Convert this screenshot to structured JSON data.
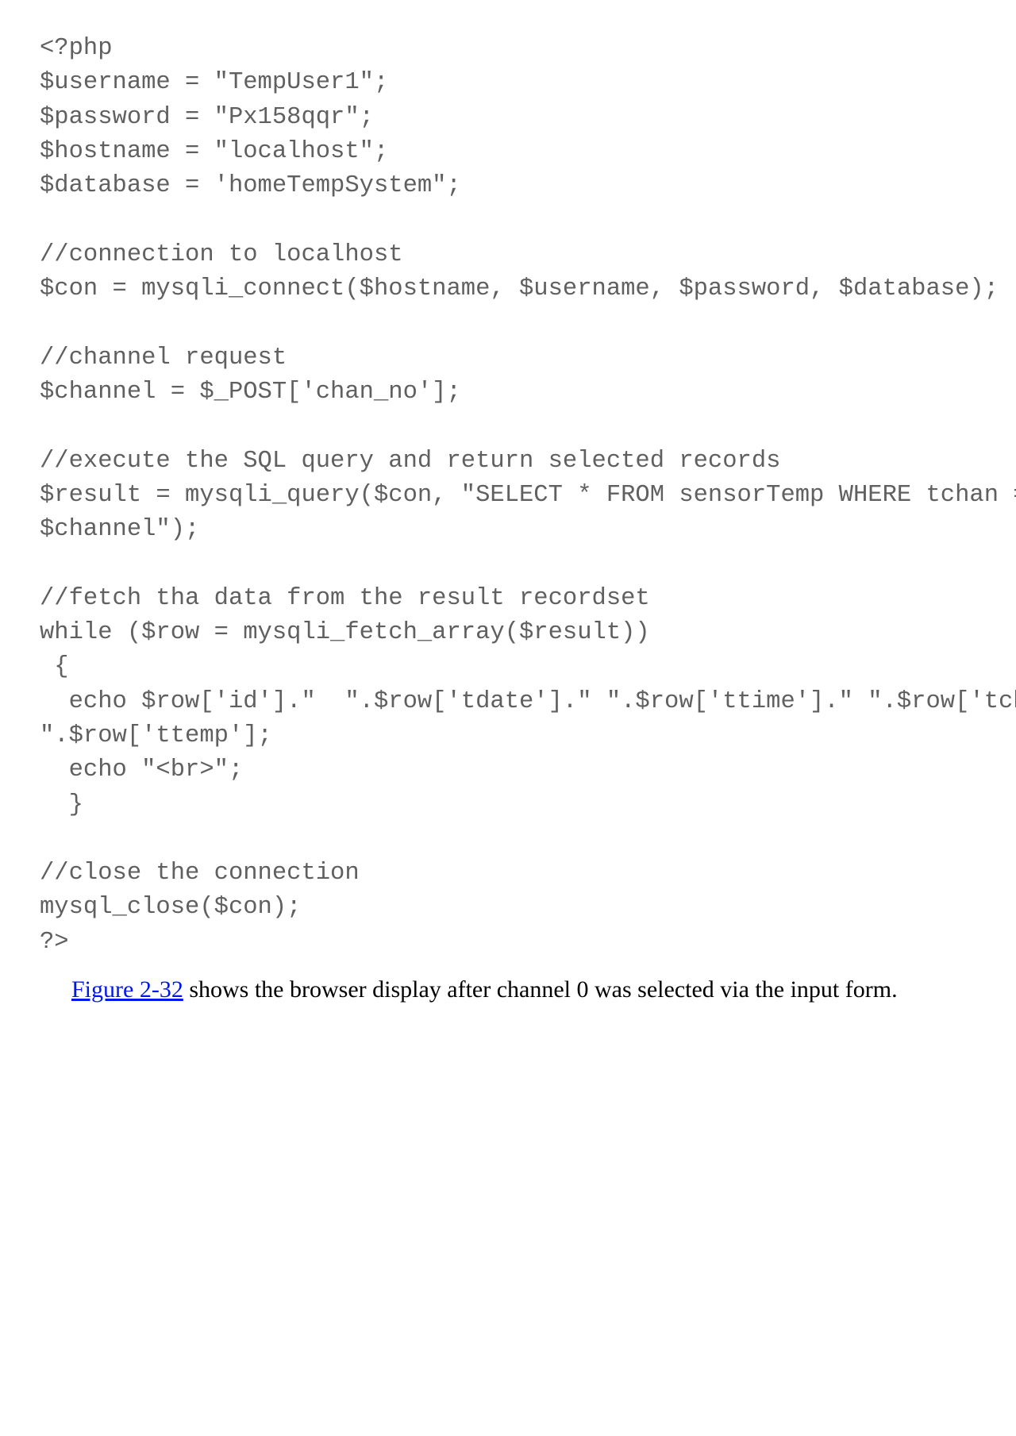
{
  "code": {
    "line1": "<?php",
    "line2": "$username = \"TempUser1\";",
    "line3": "$password = \"Px158qqr\";",
    "line4": "$hostname = \"localhost\";",
    "line5": "$database = 'homeTempSystem\";",
    "line6": "",
    "line7": "//connection to localhost",
    "line8": "$con = mysqli_connect($hostname, $username, $password, $database);",
    "line9": "",
    "line10": "//channel request",
    "line11": "$channel = $_POST['chan_no'];",
    "line12": "",
    "line13": "//execute the SQL query and return selected records",
    "line14": "$result = mysqli_query($con, \"SELECT * FROM sensorTemp WHERE tchan =",
    "line15": "$channel\");",
    "line16": "",
    "line17": "//fetch tha data from the result recordset",
    "line18": "while ($row = mysqli_fetch_array($result))",
    "line19": " {",
    "line20": "  echo $row['id'].\"  \".$row['tdate'].\" \".$row['ttime'].\" \".$row['tchan'].\"",
    "line21": "\".$row['ttemp'];",
    "line22": "  echo \"<br>\";",
    "line23": "  }",
    "line24": "",
    "line25": "//close the connection",
    "line26": "mysql_close($con);",
    "line27": "?>"
  },
  "caption": {
    "link_text": "Figure 2-32",
    "rest_text": " shows the browser display after channel 0 was selected via the input form."
  }
}
